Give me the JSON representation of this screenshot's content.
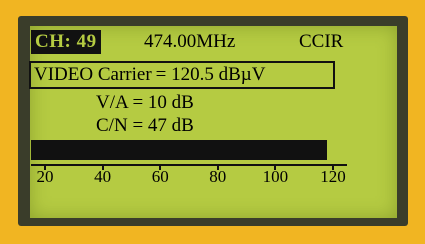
{
  "display": {
    "channel": "CH: 49",
    "frequency": "474.00MHz",
    "standard": "CCIR",
    "carrier_label": "VIDEO Carrier",
    "carrier_value": "= 120.5 dBµV",
    "va_label": "V/A",
    "va_value": "= 10 dB",
    "cn_label": "C/N",
    "cn_value": "= 47 dB"
  },
  "level_bar": {
    "level": 118,
    "scale_min": 20,
    "scale_max": 120,
    "scale_labels": [
      "20",
      "40",
      "60",
      "80",
      "100",
      "120"
    ]
  },
  "colors": {
    "lcd_background": "#b5cb42",
    "segment": "#111111",
    "frame": "#f1b522"
  }
}
